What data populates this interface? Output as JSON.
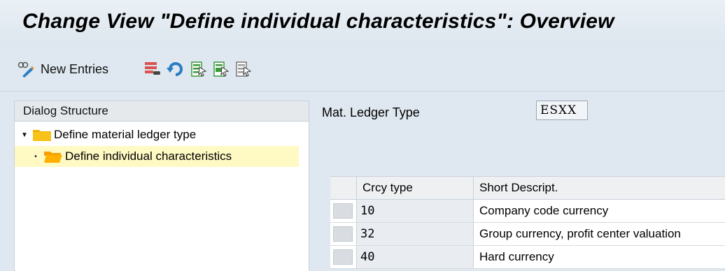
{
  "window": {
    "title": "Change View \"Define individual characteristics\": Overview"
  },
  "toolbar": {
    "new_entries_label": "New Entries",
    "icons": [
      "display-change-icon",
      "delete-icon",
      "undo-icon",
      "select-all-icon",
      "select-block-icon",
      "deselect-all-icon"
    ]
  },
  "dialog_structure": {
    "header": "Dialog Structure",
    "items": [
      {
        "label": "Define material ledger type",
        "expanded": true
      },
      {
        "label": "Define individual characteristics",
        "selected": true
      }
    ]
  },
  "form": {
    "mat_ledger_type_label": "Mat. Ledger Type",
    "mat_ledger_type_value": "ESXX"
  },
  "table": {
    "columns": [
      "Crcy type",
      "Short Descript."
    ],
    "rows": [
      {
        "crcy_type": "10",
        "description": "Company code currency"
      },
      {
        "crcy_type": "32",
        "description": "Group currency, profit center valuation"
      },
      {
        "crcy_type": "40",
        "description": "Hard currency"
      }
    ]
  },
  "colors": {
    "background": "#dfe8f0",
    "selected_row": "#fff9c4",
    "folder": "#f5b400"
  }
}
